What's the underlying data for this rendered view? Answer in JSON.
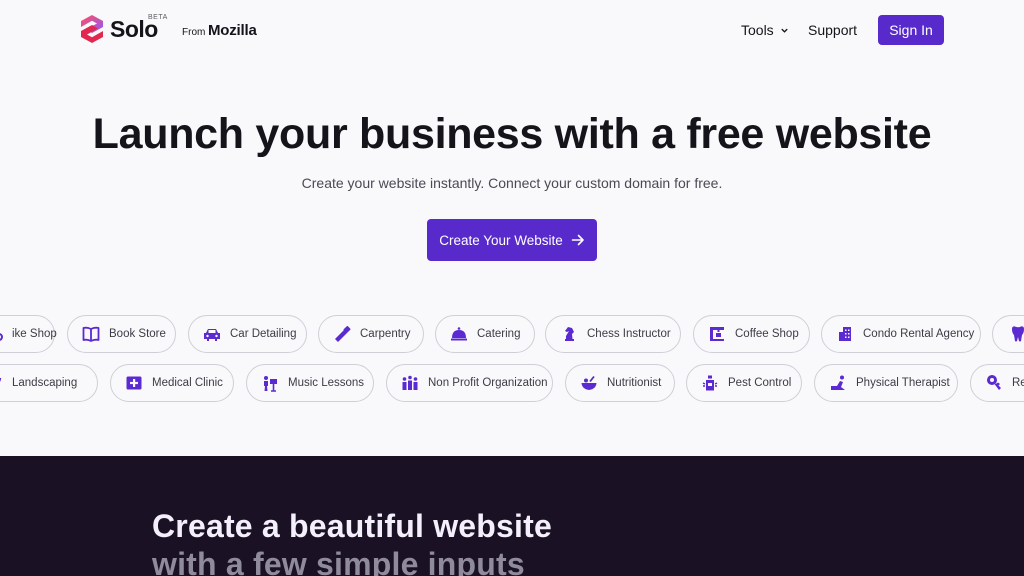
{
  "header": {
    "logo_word": "Solo",
    "beta": "BETA",
    "from": "From",
    "mozilla": "Mozilla",
    "nav": {
      "tools": "Tools",
      "support": "Support",
      "sign_in": "Sign In"
    }
  },
  "hero": {
    "title": "Launch your business with a free website",
    "subtitle": "Create your website instantly. Connect your custom domain for free.",
    "cta": "Create Your Website"
  },
  "categories_row1": [
    {
      "label": "ike Shop",
      "icon": "bike-icon"
    },
    {
      "label": "Book Store",
      "icon": "book-icon"
    },
    {
      "label": "Car Detailing",
      "icon": "car-icon"
    },
    {
      "label": "Carpentry",
      "icon": "saw-icon"
    },
    {
      "label": "Catering",
      "icon": "cloche-icon"
    },
    {
      "label": "Chess Instructor",
      "icon": "chess-knight-icon"
    },
    {
      "label": "Coffee Shop",
      "icon": "coffee-machine-icon"
    },
    {
      "label": "Condo Rental Agency",
      "icon": "building-icon"
    },
    {
      "label": "",
      "icon": "tooth-icon"
    }
  ],
  "categories_row2": [
    {
      "label": "Landscaping",
      "icon": "plant-icon"
    },
    {
      "label": "Medical Clinic",
      "icon": "medical-cross-icon"
    },
    {
      "label": "Music Lessons",
      "icon": "music-stand-icon"
    },
    {
      "label": "Non Profit Organization",
      "icon": "people-icon"
    },
    {
      "label": "Nutritionist",
      "icon": "food-bowl-icon"
    },
    {
      "label": "Pest Control",
      "icon": "spray-icon"
    },
    {
      "label": "Physical Therapist",
      "icon": "therapy-icon"
    },
    {
      "label": "Re",
      "icon": "key-icon"
    }
  ],
  "section": {
    "line1": "Create a beautiful website",
    "line2": "with a few simple inputs"
  },
  "colors": {
    "accent": "#592acb",
    "icon": "#5b2ad0",
    "dark_bg": "#1a1125"
  }
}
